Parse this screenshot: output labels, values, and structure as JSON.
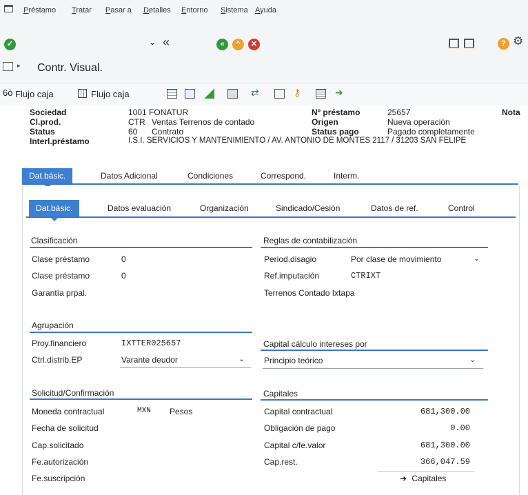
{
  "menu": [
    "Préstamo",
    "Tratar",
    "Pasar a",
    "Detalles",
    "Entorno",
    "Sistema",
    "Ayuda"
  ],
  "toolbar": {
    "back_label": "«"
  },
  "title": "Contr. Visual.",
  "app_toolbar": {
    "flujo1": "Flujo caja",
    "flujo2": "Flujo caja"
  },
  "header": {
    "sociedad_label": "Sociedad",
    "sociedad_value": "1001 FONATUR",
    "clprod_label": "Cl.prod.",
    "clprod_code": "CTR",
    "clprod_text": "Ventas Terrenos de contado",
    "status_label": "Status",
    "status_code": "60",
    "status_text": "Contrato",
    "interl_label": "Interl.préstamo",
    "interl_value": "I.S.I. SERVICIOS Y MANTENIMIENTO / AV. ANTONIO DE MONTES 2117 / 31203 SAN FELIPE",
    "nprestamo_label": "Nº préstamo",
    "nprestamo_value": "25657",
    "origen_label": "Origen",
    "origen_value": "Nueva operación",
    "statuspago_label": "Status pago",
    "statuspago_value": "Pagado completamente",
    "nota_label": "Nota"
  },
  "tabs": [
    "Dat.básic.",
    "Datos Adicional",
    "Condiciones",
    "Correspond.",
    "Interm."
  ],
  "subtabs": [
    "Dat.básic.",
    "Datos evaluación",
    "Organización",
    "Sindicado/Cesión",
    "Datos de ref.",
    "Control"
  ],
  "clasificacion": {
    "title": "Clasificación",
    "clase1_label": "Clase préstamo",
    "clase1_value": "0",
    "clase2_label": "Clase préstamo",
    "clase2_value": "0",
    "garantia_label": "Garantía prpal."
  },
  "reglas": {
    "title": "Reglas de contabilización",
    "periodo_label": "Period.disagio",
    "periodo_value": "Por clase de movimiento",
    "refimp_label": "Ref.imputación",
    "refimp_value": "CTRIXT",
    "terrenos": "Terrenos Contado Ixtapa"
  },
  "agrupacion": {
    "title": "Agrupación",
    "proy_label": "Proy.financiero",
    "proy_value": "IXTTER025657",
    "ctrl_label": "Ctrl.distrib.EP",
    "ctrl_value": "Varante deudor"
  },
  "capital_calc": {
    "title": "Capital cálculo intereses por",
    "value": "Principio teórico"
  },
  "solicitud": {
    "title": "Solicitud/Confirmación",
    "moneda_label": "Moneda contractual",
    "moneda_code": "MXN",
    "moneda_text": "Pesos",
    "fecha_label": "Fecha de solicitud",
    "cap_label": "Cap.solicitado",
    "feaut_label": "Fe.autorización",
    "fesus_label": "Fe.suscripción"
  },
  "capitales": {
    "title": "Capitales",
    "contractual_label": "Capital contractual",
    "contractual_value": "681,300.00",
    "obligacion_label": "Obligación de pago",
    "obligacion_value": "0.00",
    "cfevalor_label": "Capital c/fe.valor",
    "cfevalor_value": "681,300.00",
    "caprest_label": "Cap.rest.",
    "caprest_value": "366,047.59",
    "button_label": "Capitales"
  },
  "colors": {
    "accent": "#3d7fd0",
    "ok": "#2f9a3a",
    "warn": "#f0a030",
    "cancel": "#d23a3a"
  }
}
